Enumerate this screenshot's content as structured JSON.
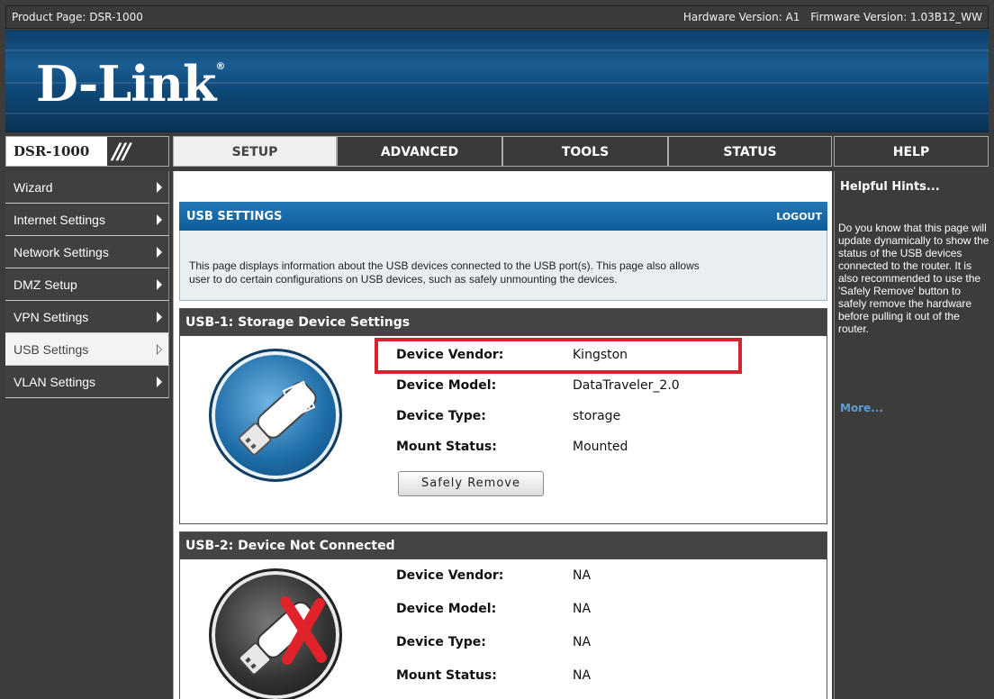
{
  "topbar": {
    "product": "Product Page: DSR-1000",
    "hardware": "Hardware Version: A1",
    "firmware": "Firmware Version: 1.03B12_WW"
  },
  "brand": {
    "logo": "D-Link",
    "reg": "®"
  },
  "model": "DSR-1000",
  "tabs": [
    "SETUP",
    "ADVANCED",
    "TOOLS",
    "STATUS",
    "HELP"
  ],
  "active_tab": "SETUP",
  "sidebar": {
    "items": [
      {
        "label": "Wizard"
      },
      {
        "label": "Internet Settings"
      },
      {
        "label": "Network Settings"
      },
      {
        "label": "DMZ Setup"
      },
      {
        "label": "VPN Settings"
      },
      {
        "label": "USB Settings"
      },
      {
        "label": "VLAN Settings"
      }
    ],
    "active": "USB Settings"
  },
  "main": {
    "header_title": "USB SETTINGS",
    "logout": "LOGOUT",
    "description_line1": "This page displays information about the USB devices connected to the USB port(s). This page also allows",
    "description_line2": "user to do certain configurations on USB devices, such as safely unmounting the devices.",
    "usb1": {
      "title": "USB-1: Storage Device Settings",
      "fields": [
        {
          "label": "Device Vendor:",
          "value": "Kingston"
        },
        {
          "label": "Device Model:",
          "value": "DataTraveler_2.0"
        },
        {
          "label": "Device Type:",
          "value": "storage"
        },
        {
          "label": "Mount Status:",
          "value": "Mounted"
        }
      ],
      "button": "Safely Remove"
    },
    "usb2": {
      "title": "USB-2: Device Not Connected",
      "fields": [
        {
          "label": "Device Vendor:",
          "value": "NA"
        },
        {
          "label": "Device Model:",
          "value": "NA"
        },
        {
          "label": "Device Type:",
          "value": "NA"
        },
        {
          "label": "Mount Status:",
          "value": "NA"
        }
      ]
    }
  },
  "help": {
    "title": "Helpful Hints...",
    "body": "Do you know that this page will update dynamically to show the status of the USB devices connected to the router. It is also recommended to use the 'Safely Remove' button to safely remove the hardware before pulling it out of the router.",
    "more": "More..."
  },
  "colors": {
    "header_blue": "#1565a3",
    "highlight_red": "#d6222e",
    "dark_bg": "#3c3c3c"
  }
}
